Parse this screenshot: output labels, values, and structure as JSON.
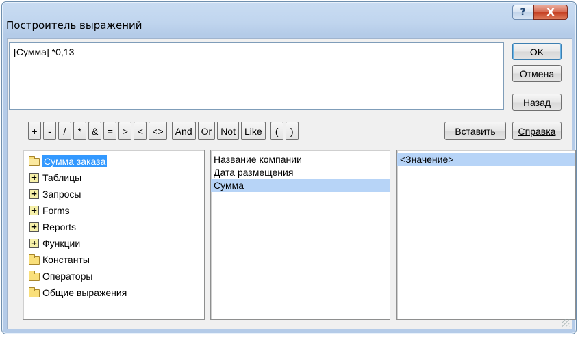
{
  "window": {
    "title": "Построитель выражений",
    "help_glyph": "?",
    "close_glyph": "X"
  },
  "expression": {
    "value": "[Сумма] *0,13"
  },
  "buttons": {
    "ok": "OK",
    "cancel": "Отмена",
    "back": "Назад",
    "help": "Справка",
    "insert": "Вставить"
  },
  "operators": [
    "+",
    "-",
    "/",
    "*",
    "&",
    "=",
    ">",
    "<",
    "<>",
    "And",
    "Or",
    "Not",
    "Like",
    "(",
    ")"
  ],
  "tree": [
    {
      "label": "Сумма заказа",
      "icon": "folder-open-icon",
      "selected": true
    },
    {
      "label": "Таблицы",
      "icon": "plus-icon"
    },
    {
      "label": "Запросы",
      "icon": "plus-icon"
    },
    {
      "label": "Forms",
      "icon": "plus-icon"
    },
    {
      "label": "Reports",
      "icon": "plus-icon"
    },
    {
      "label": "Функции",
      "icon": "plus-icon"
    },
    {
      "label": "Константы",
      "icon": "folder-icon"
    },
    {
      "label": "Операторы",
      "icon": "folder-icon"
    },
    {
      "label": "Общие выражения",
      "icon": "folder-icon"
    }
  ],
  "fields": [
    {
      "label": "Название компании"
    },
    {
      "label": "Дата размещения"
    },
    {
      "label": "Сумма",
      "selected": true
    }
  ],
  "values": [
    {
      "label": "<Значение>",
      "selected": true
    }
  ],
  "colors": {
    "selection": "#3399ff",
    "list_selection": "#b7d4f7"
  }
}
